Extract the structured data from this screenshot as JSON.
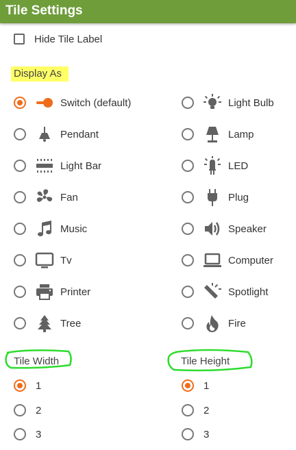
{
  "header": {
    "title": "Tile Settings"
  },
  "hide_label": {
    "label": "Hide Tile Label",
    "checked": false
  },
  "display_as": {
    "heading": "Display As",
    "options": [
      {
        "label": "Switch (default)",
        "icon": "switch-icon",
        "selected": true
      },
      {
        "label": "Light Bulb",
        "icon": "light-bulb-icon",
        "selected": false
      },
      {
        "label": "Pendant",
        "icon": "pendant-icon",
        "selected": false
      },
      {
        "label": "Lamp",
        "icon": "lamp-icon",
        "selected": false
      },
      {
        "label": "Light Bar",
        "icon": "light-bar-icon",
        "selected": false
      },
      {
        "label": "LED",
        "icon": "led-icon",
        "selected": false
      },
      {
        "label": "Fan",
        "icon": "fan-icon",
        "selected": false
      },
      {
        "label": "Plug",
        "icon": "plug-icon",
        "selected": false
      },
      {
        "label": "Music",
        "icon": "music-icon",
        "selected": false
      },
      {
        "label": "Speaker",
        "icon": "speaker-icon",
        "selected": false
      },
      {
        "label": "Tv",
        "icon": "tv-icon",
        "selected": false
      },
      {
        "label": "Computer",
        "icon": "computer-icon",
        "selected": false
      },
      {
        "label": "Printer",
        "icon": "printer-icon",
        "selected": false
      },
      {
        "label": "Spotlight",
        "icon": "spotlight-icon",
        "selected": false
      },
      {
        "label": "Tree",
        "icon": "tree-icon",
        "selected": false
      },
      {
        "label": "Fire",
        "icon": "fire-icon",
        "selected": false
      }
    ]
  },
  "tile_width": {
    "heading": "Tile Width",
    "options": [
      "1",
      "2",
      "3"
    ],
    "selected": "1"
  },
  "tile_height": {
    "heading": "Tile Height",
    "options": [
      "1",
      "2",
      "3"
    ],
    "selected": "1"
  },
  "colors": {
    "header": "#6e9d3a",
    "accent": "#ef6c1a",
    "icon": "#616161",
    "highlight": "#ffff66",
    "annotation": "#2ddc2d"
  }
}
